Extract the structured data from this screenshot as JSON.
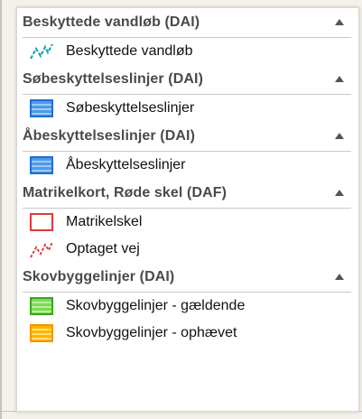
{
  "sections": [
    {
      "title": "Beskyttede vandløb (DAI)",
      "items": [
        {
          "label": "Beskyttede vandløb",
          "icon": "teal-zigzag-line-icon"
        }
      ]
    },
    {
      "title": "Søbeskyttelseslinjer (DAI)",
      "items": [
        {
          "label": "Søbeskyttelseslinjer",
          "icon": "blue-striped-swatch-icon"
        }
      ]
    },
    {
      "title": "Åbeskyttelseslinjer (DAI)",
      "items": [
        {
          "label": "Åbeskyttelseslinjer",
          "icon": "blue-striped-swatch-icon"
        }
      ]
    },
    {
      "title": "Matrikelkort, Røde skel (DAF)",
      "items": [
        {
          "label": "Matrikelskel",
          "icon": "red-outline-swatch-icon"
        },
        {
          "label": "Optaget vej",
          "icon": "red-dashed-zigzag-icon"
        }
      ]
    },
    {
      "title": "Skovbyggelinjer (DAI)",
      "items": [
        {
          "label": "Skovbyggelinjer - gældende",
          "icon": "green-striped-swatch-icon"
        },
        {
          "label": "Skovbyggelinjer - ophævet",
          "icon": "orange-striped-swatch-icon"
        }
      ]
    }
  ],
  "colors": {
    "teal": "#1aa3b8",
    "blue": "#1f6fd1",
    "red": "#e23a3a",
    "green": "#3aa61b",
    "orange": "#f29600"
  }
}
